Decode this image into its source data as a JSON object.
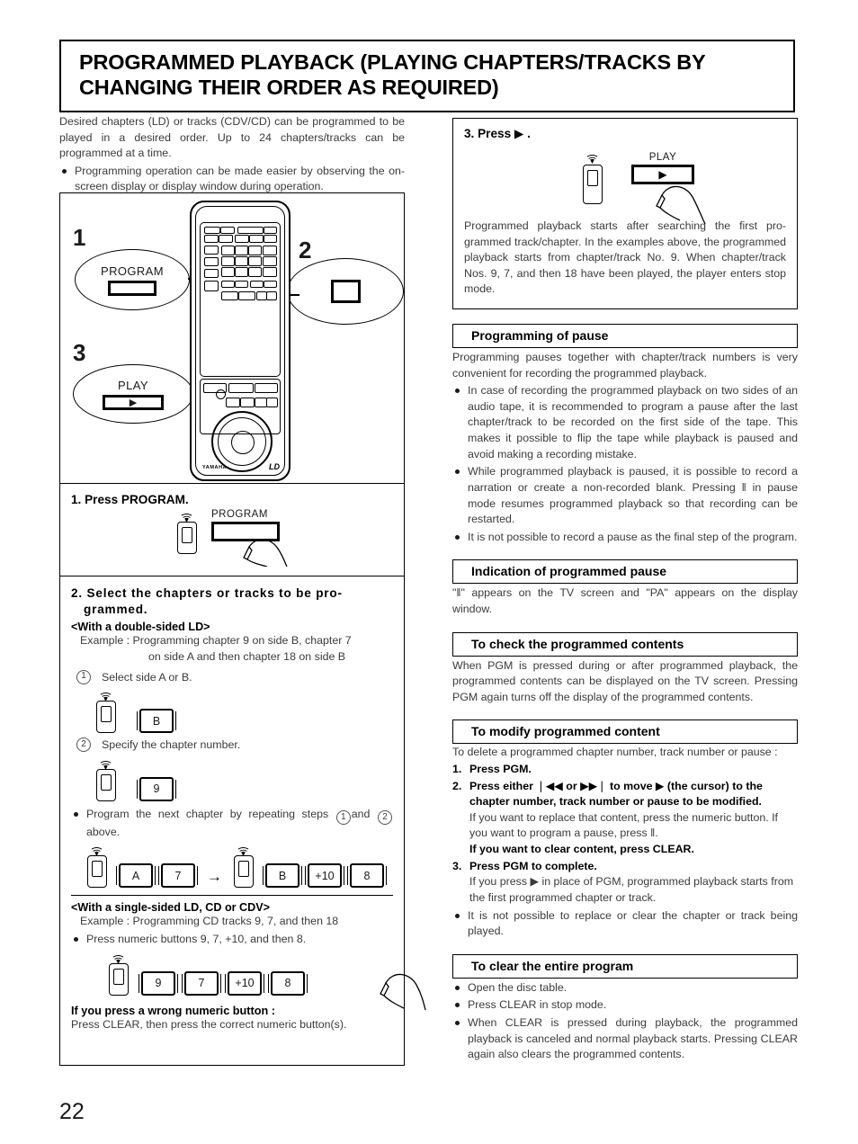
{
  "page": {
    "number": "22",
    "title": "PROGRAMMED PLAYBACK (PLAYING CHAPTERS/TRACKS BY CHANGING THEIR ORDER AS REQUIRED)"
  },
  "intro": {
    "paragraph": "Desired chapters (LD) or tracks (CDV/CD) can be programmed to be played in a desired order. Up to 24 chapters/tracks can be programmed at a time.",
    "bullet1": "Programming operation can be made easier by observing the on-screen display or display window during operation."
  },
  "remote_diagram": {
    "callout1_number": "1",
    "callout1_label": "PROGRAM",
    "callout2_number": "2",
    "callout3_number": "3",
    "callout3_label": "PLAY",
    "brand": "YAMAHA",
    "logo": "LD"
  },
  "step1": {
    "heading": "1. Press PROGRAM.",
    "key_caption": "PROGRAM"
  },
  "step2": {
    "heading": "2. Select the chapters or tracks to be pro-grammed.",
    "double_sided_head": "<With a double-sided LD>",
    "example_label": "Example :",
    "example_line1": "Programming chapter 9 on side B, chapter 7",
    "example_line2": "on side A and then chapter 18 on side B",
    "sub1": "Select side A or B.",
    "sub1_key": "B",
    "sub2": "Specify the chapter number.",
    "sub2_key": "9",
    "repeat_bullet_a": "Program the next chapter by repeating steps",
    "repeat_bullet_b": "and",
    "repeat_bullet_c": "above.",
    "seq_keys_left": [
      "A",
      "7"
    ],
    "seq_arrow": "→",
    "seq_keys_right": [
      "B",
      "+10",
      "8"
    ],
    "single_sided_head": "<With a single-sided LD, CD or CDV>",
    "single_example_label": "Example :",
    "single_example": "Programming CD tracks 9, 7, and then 18",
    "single_bullet": "Press numeric buttons 9, 7, +10, and then 8.",
    "single_keys": [
      "9",
      "7",
      "+10",
      "8"
    ],
    "wrong_head": "If you press a wrong numeric button :",
    "wrong_body": "Press CLEAR, then press the correct numeric button(s)."
  },
  "step3": {
    "heading": "3. Press ▶ .",
    "key_caption": "PLAY",
    "body": "Programmed playback starts after searching the first pro-grammed track/chapter. In the examples above, the programmed playback starts from chapter/track No. 9. When chapter/track Nos. 9, 7, and then 18 have been played, the player enters stop mode."
  },
  "sections": [
    {
      "id": "programming-of-pause",
      "title": "Programming of pause",
      "body": "Programming pauses together with chapter/track numbers is very convenient for recording the programmed playback.",
      "bullets": [
        "In case of recording the programmed playback on two sides of an audio tape, it is recommended to program a pause after the last chapter/track to be recorded on the first side of the tape. This makes it possible to flip the tape while playback is paused and avoid making a recording mistake.",
        "While programmed playback is paused, it is possible to record a narration or create a non-recorded blank. Pressing ‖ in pause mode resumes programmed playback so that recording can be restarted.",
        "It is not possible to record a pause as the final step of the program."
      ]
    },
    {
      "id": "indication-of-programmed-pause",
      "title": "Indication of programmed pause",
      "body": "\"‖\" appears on the TV screen and \"PA\" appears on the display window.",
      "bullets": []
    },
    {
      "id": "to-check-the-programmed-contents",
      "title": "To check the programmed contents",
      "body": "When PGM is pressed during or after programmed playback, the programmed contents can be displayed on the TV screen. Pressing PGM again turns off the display of the programmed contents.",
      "bullets": []
    },
    {
      "id": "to-modify-programmed-content",
      "title": "To modify programmed content",
      "body": "To delete a programmed chapter number, track number or pause :",
      "bullets": []
    },
    {
      "id": "to-clear-the-entire-program",
      "title": "To clear the entire program",
      "body": "",
      "bullets": [
        "Open the disc table.",
        "Press CLEAR in stop mode.",
        "When CLEAR is pressed during playback, the programmed playback is canceled and normal playback starts. Pressing CLEAR again also clears the programmed contents."
      ]
    }
  ],
  "modify_steps": {
    "s1_num": "1.",
    "s1_text": "Press PGM.",
    "s2_num": "2.",
    "s2_text": "Press either ❘◀◀ or ▶▶❘ to move ▶ (the cursor) to the chapter number, track number or pause to be modified.",
    "s2_sub1": "If you want to replace that content, press the numeric button. If you want to program a pause, press ‖.",
    "s2_sub2": "If you want to clear content, press CLEAR.",
    "s3_num": "3.",
    "s3_text": "Press PGM to complete.",
    "s3_sub": "If you press ▶ in place of PGM, programmed playback starts from the first programmed chapter or track.",
    "final_bullet": "It is not possible to replace or clear the chapter or track being played."
  },
  "colors": {
    "ink": "#1a1a1a",
    "body_text": "#3b3b3b",
    "rule": "#000000",
    "paper": "#ffffff"
  }
}
